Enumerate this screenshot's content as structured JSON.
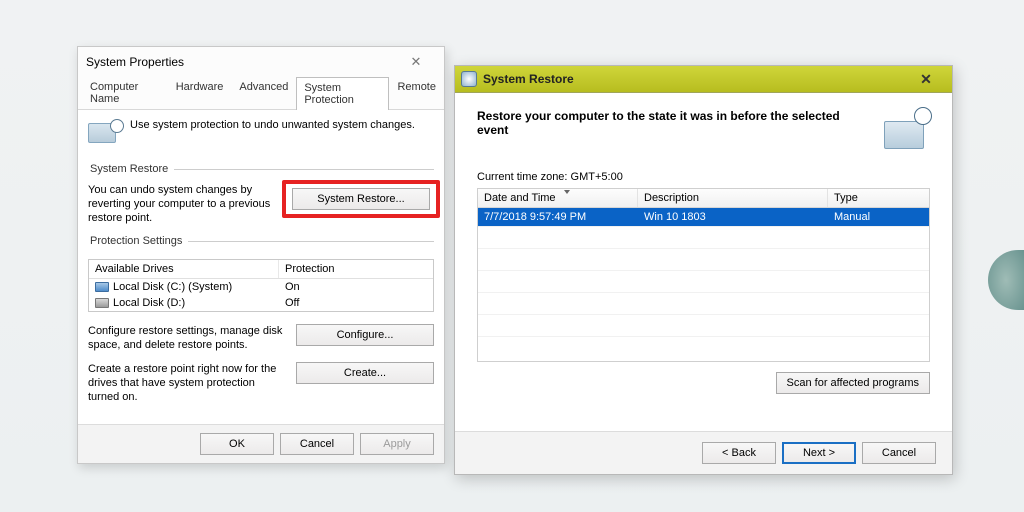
{
  "left": {
    "title": "System Properties",
    "tabs": [
      "Computer Name",
      "Hardware",
      "Advanced",
      "System Protection",
      "Remote"
    ],
    "active_tab": 3,
    "intro": "Use system protection to undo unwanted system changes.",
    "group_restore": {
      "legend": "System Restore",
      "text": "You can undo system changes by reverting your computer to a previous restore point.",
      "button": "System Restore..."
    },
    "group_protect": {
      "legend": "Protection Settings",
      "col_drive": "Available Drives",
      "col_prot": "Protection",
      "drives": [
        {
          "name": "Local Disk (C:) (System)",
          "prot": "On",
          "sys": true
        },
        {
          "name": "Local Disk (D:)",
          "prot": "Off",
          "sys": false
        }
      ],
      "configure_text": "Configure restore settings, manage disk space, and delete restore points.",
      "configure_btn": "Configure...",
      "create_text": "Create a restore point right now for the drives that have system protection turned on.",
      "create_btn": "Create..."
    },
    "footer": {
      "ok": "OK",
      "cancel": "Cancel",
      "apply": "Apply"
    }
  },
  "right": {
    "title": "System Restore",
    "heading": "Restore your computer to the state it was in before the selected event",
    "timezone": "Current time zone: GMT+5:00",
    "cols": {
      "c1": "Date and Time",
      "c2": "Description",
      "c3": "Type"
    },
    "rows": [
      {
        "dt": "7/7/2018 9:57:49 PM",
        "desc": "Win 10 1803",
        "type": "Manual",
        "selected": true
      }
    ],
    "scan_btn": "Scan for affected programs",
    "footer": {
      "back": "< Back",
      "next": "Next >",
      "cancel": "Cancel"
    }
  }
}
